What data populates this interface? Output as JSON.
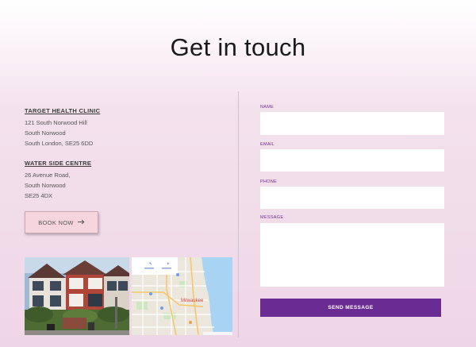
{
  "title": "Get in touch",
  "locations": [
    {
      "name": "TARGET HEALTH CLINIC",
      "lines": [
        "121 South Norwood Hill",
        "South Norwood",
        "South London, SE25 6DD"
      ]
    },
    {
      "name": "WATER SIDE CENTRE",
      "lines": [
        "26 Avenue Road,",
        "South Norwood",
        "SE25 4DX"
      ]
    }
  ],
  "book_button": {
    "label": "BOOK NOW",
    "icon": "arrow-right-icon"
  },
  "map": {
    "city_label": "Milwaukee"
  },
  "form": {
    "name_label": "NAME",
    "email_label": "EMAIL",
    "phone_label": "PHONE",
    "message_label": "MESSAGE",
    "send_label": "SEND MESSAGE"
  },
  "colors": {
    "accent": "#6a2c92",
    "button_pink": "#f7d5df",
    "background": "#efd6e7"
  }
}
